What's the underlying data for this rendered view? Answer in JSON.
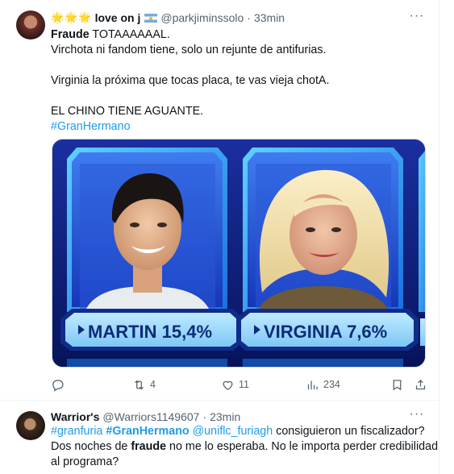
{
  "tweets": [
    {
      "stars": "🌟🌟🌟",
      "name": "love on j",
      "handle": "@parkjiminssolo",
      "time": "33min",
      "line1_bold": "Fraude",
      "line1_rest": " TOTAAAAAAL.",
      "line2": "Virchota ni fandom tiene, solo un rejunte de antifurias.",
      "line3": "Virginia la próxima que tocas placa, te vas vieja chotA.",
      "line4": "EL CHINO TIENE AGUANTE.",
      "hashtag": "#GranHermano",
      "media": {
        "left_label": "MARTIN 15,4%",
        "right_label": "VIRGINIA 7,6%"
      },
      "actions": {
        "reply": "",
        "retweet": "4",
        "like": "11",
        "views": "234",
        "bookmark": "",
        "share": ""
      }
    },
    {
      "name": "Warrior's",
      "handle": "@Warriors1149607",
      "time": "23min",
      "tag1": "#granfuria",
      "tag2": "#GranHermano",
      "mention": "@uniflc_furiagh",
      "text1": " consiguieron un fiscalizador?",
      "text2_pre": "Dos noches de ",
      "text2_bold": "fraude",
      "text2_post": " no me lo esperaba. No le importa perder credibilidad",
      "text3": "al programa?"
    }
  ],
  "icons": {
    "more": "more-horizontal-icon",
    "reply": "reply-icon",
    "retweet": "retweet-icon",
    "like": "heart-icon",
    "views": "analytics-icon",
    "bookmark": "bookmark-icon",
    "share": "share-icon"
  },
  "colors": {
    "accent": "#1d9bf0",
    "text": "#0f1419",
    "secondary": "#536471",
    "star": "#f4a71d"
  }
}
